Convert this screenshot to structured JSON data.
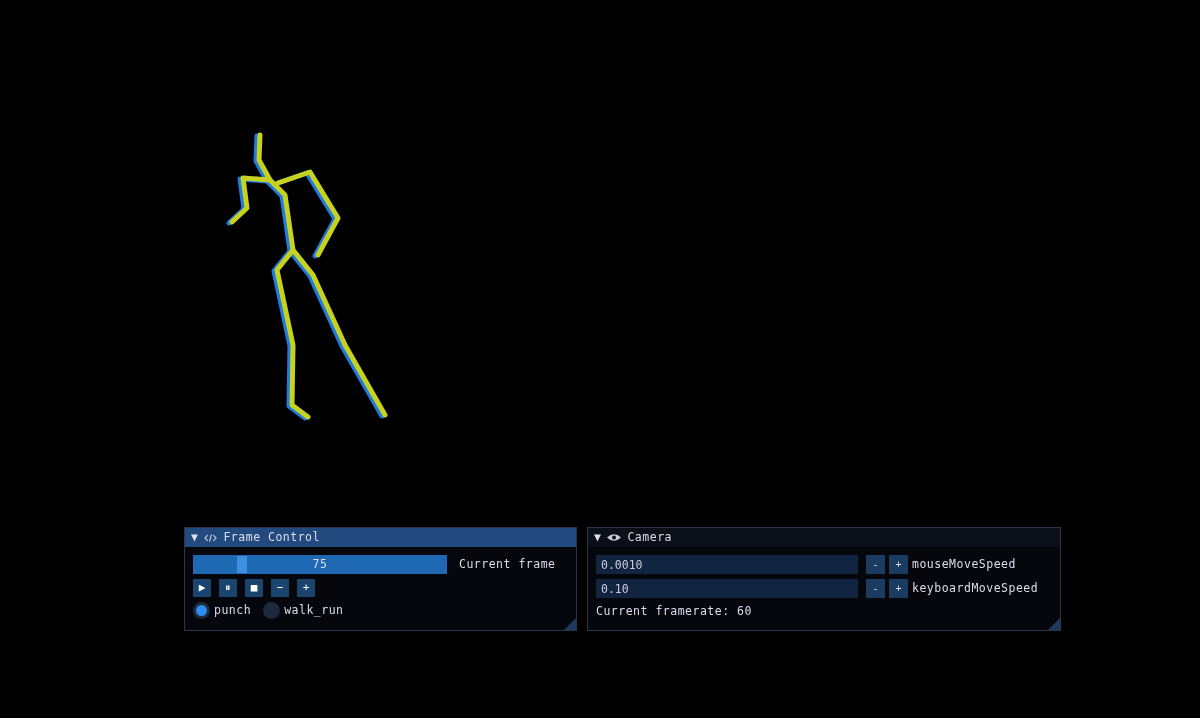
{
  "panels": [
    {
      "kind": "frame",
      "title": "Frame Control",
      "collapse": "▼",
      "active": true,
      "slider": {
        "value": "75",
        "level": 0.18,
        "label": "Current frame"
      },
      "buttons": [
        "▶",
        "⏸",
        "■",
        "−",
        "+"
      ],
      "radios": [
        {
          "label": "punch",
          "selected": true
        },
        {
          "label": "walk_run",
          "selected": false
        }
      ]
    },
    {
      "kind": "camera",
      "title": "Camera",
      "collapse": "▼",
      "active": false,
      "inputs": [
        {
          "value": "0.0010",
          "minus": "-",
          "plus": "+",
          "label": "mouseMoveSpeed"
        },
        {
          "value": "0.10",
          "minus": "-",
          "plus": "+",
          "label": "keyboardMoveSpeed"
        }
      ],
      "status": "Current framerate: 60"
    }
  ]
}
